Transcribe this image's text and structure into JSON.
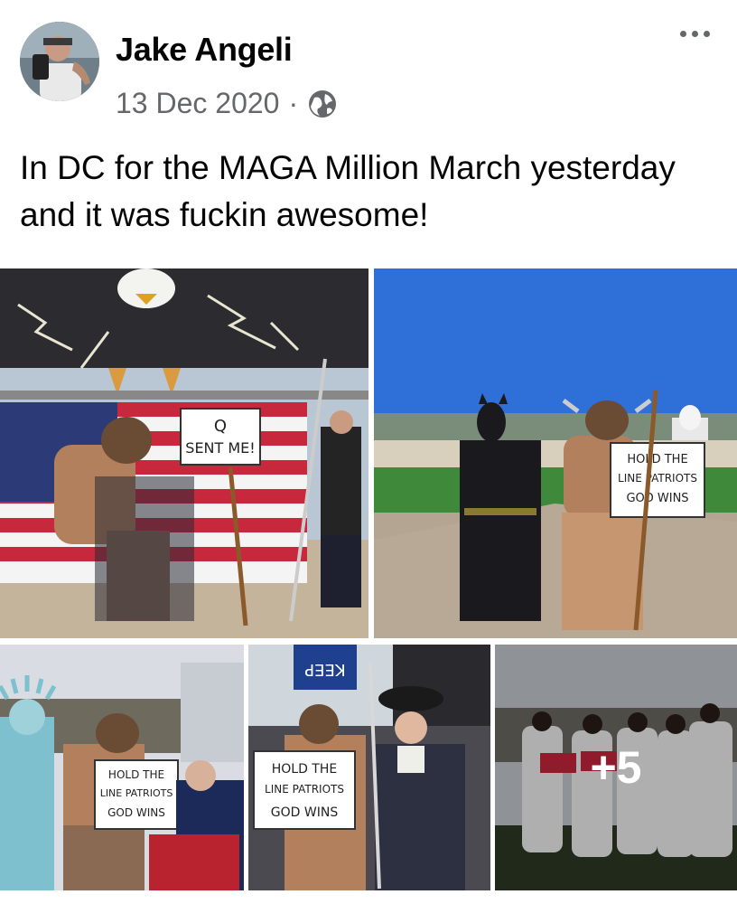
{
  "post": {
    "author": "Jake Angeli",
    "date": "13 Dec 2020",
    "separator": "·",
    "privacy_icon": "globe-icon",
    "more_icon": "more-options-icon",
    "text": "In DC for the MAGA Million March yesterday and it was fuckin awesome!"
  },
  "photos": {
    "photo1": {
      "sign_line1": "Q",
      "sign_line2": "SENT ME!"
    },
    "photo2": {
      "sign_line1": "HOLD THE",
      "sign_line2": "LINE PATRIOTS",
      "sign_line3": "GOD WINS"
    },
    "photo3": {
      "sign_line1": "HOLD THE",
      "sign_line2": "LINE PATRIOTS",
      "sign_line3": "GOD WINS"
    },
    "photo4": {
      "sign_line1": "HOLD THE",
      "sign_line2": "LINE PATRIOTS",
      "sign_line3": "GOD WINS",
      "flag_text": "KEEP"
    },
    "photo5": {
      "overlay": "+5"
    }
  },
  "colors": {
    "text_primary": "#050505",
    "text_secondary": "#65676b",
    "background": "#ffffff"
  }
}
